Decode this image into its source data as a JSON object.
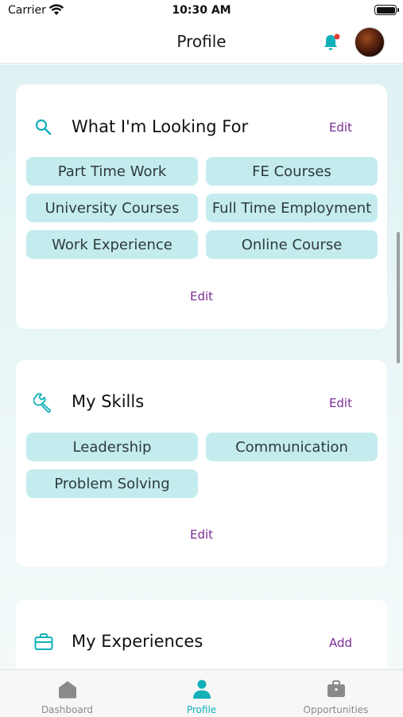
{
  "status_bar": {
    "carrier": "Carrier",
    "time": "10:30 AM"
  },
  "nav": {
    "title": "Profile"
  },
  "looking_for": {
    "title": "What I'm Looking For",
    "action": "Edit",
    "chips": [
      "Part Time Work",
      "FE Courses",
      "University Courses",
      "Full Time Employment",
      "Work Experience",
      "Online Course"
    ],
    "bottom_action": "Edit"
  },
  "skills": {
    "title": "My Skills",
    "action": "Edit",
    "chips": [
      "Leadership",
      "Communication",
      "Problem Solving"
    ],
    "bottom_action": "Edit"
  },
  "experiences": {
    "title": "My Experiences",
    "action": "Add"
  },
  "tabs": [
    {
      "label": "Dashboard",
      "icon": "home-icon"
    },
    {
      "label": "Profile",
      "icon": "person-icon"
    },
    {
      "label": "Opportunities",
      "icon": "briefcase-icon"
    }
  ],
  "colors": {
    "accent": "#12b0b8",
    "action": "#7b2d95",
    "chip_bg": "#c4ecee",
    "notification_dot": "#e53935"
  }
}
